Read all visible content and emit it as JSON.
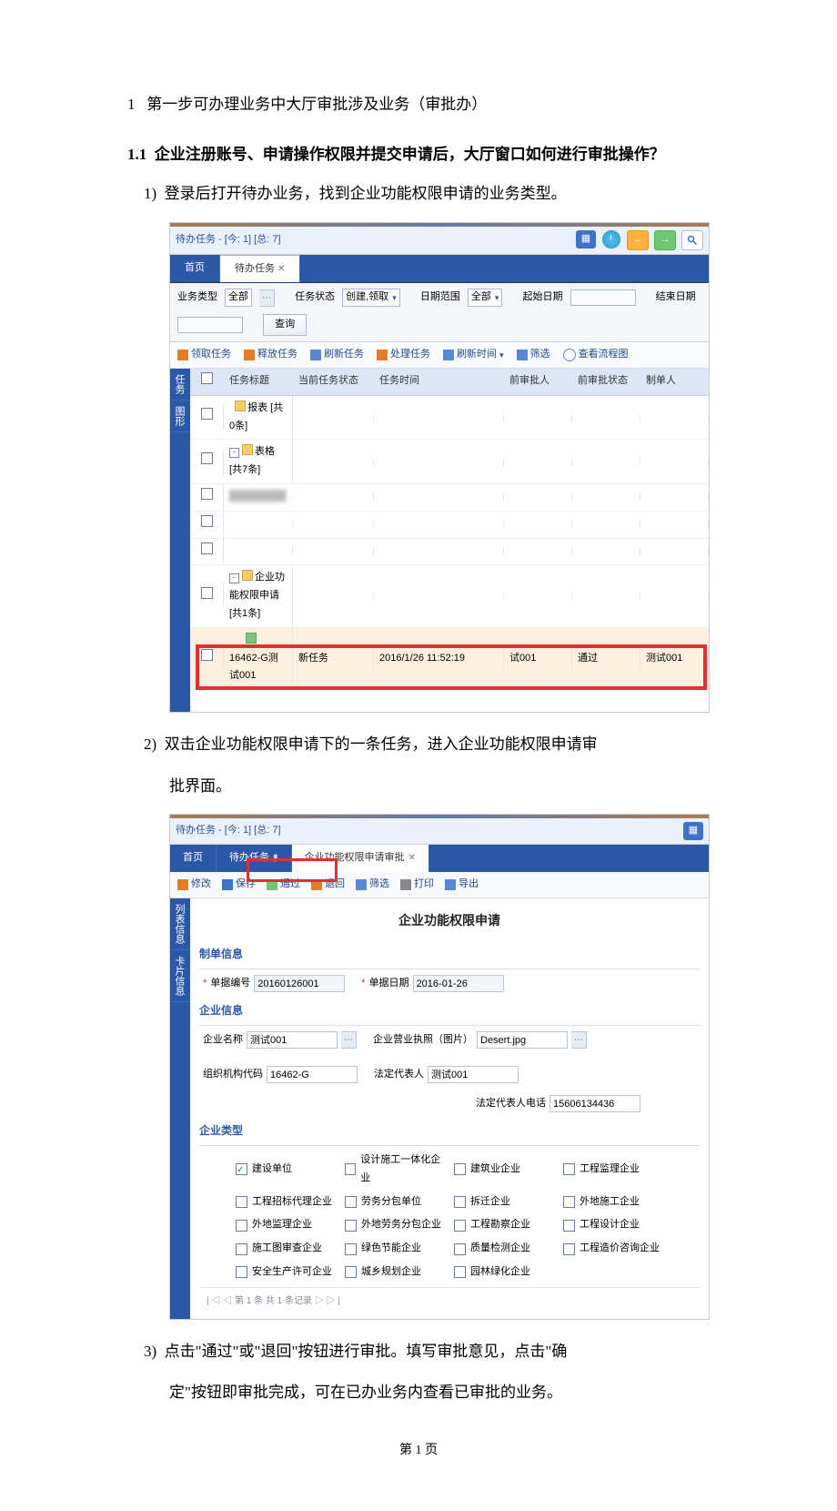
{
  "doc": {
    "h1_num": "1",
    "h1_text": "第一步可办理业务中大厅审批涉及业务（审批办）",
    "h2_num": "1.1",
    "h2_text": "企业注册账号、申请操作权限并提交申请后，大厅窗口如何进行审批操作？",
    "step1_num": "1)",
    "step1_text": "登录后打开待办业务，找到企业功能权限申请的业务类型。",
    "step2_num": "2)",
    "step2_text": "双击企业功能权限申请下的一条任务，进入企业功能权限申请审",
    "step2_text2": "批界面。",
    "step3_num": "3)",
    "step3_text": "点击\"通过\"或\"退回\"按钮进行审批。填写审批意见，点击\"确",
    "step3_text2": "定\"按钮即审批完成，可在已办业务内查看已审批的业务。",
    "page_footer": "第 1 页"
  },
  "app1": {
    "breadcrumb": "待办任务 - [今: 1] [总: 7]",
    "tabs": [
      "首页",
      "待办任务"
    ],
    "filter": {
      "biz_type_label": "业务类型",
      "biz_type_value": "全部",
      "task_state_label": "任务状态",
      "task_state_value": "创建,领取",
      "date_range_label": "日期范围",
      "date_range_value": "全部",
      "start_date_label": "起始日期",
      "end_date_label": "结束日期",
      "query_btn": "查询"
    },
    "toolbar": {
      "claim": "领取任务",
      "release": "释放任务",
      "refresh": "刷新任务",
      "process": "处理任务",
      "reftime": "刷新时间",
      "filter": "筛选",
      "flowchart": "查看流程图"
    },
    "sidetabs": {
      "task": "任务",
      "chart": "图形"
    },
    "columns": {
      "title": "任务标题",
      "state": "当前任务状态",
      "time": "任务时间",
      "prev_approver": "前审批人",
      "prev_state": "前审批状态",
      "maker": "制单人"
    },
    "rows": {
      "group_report": "报表 [共0条]",
      "group_form": "表格 [共7条]",
      "group_apply": "企业功能权限申请 [共1条]",
      "task_name": "16462-G测试001",
      "task_state": "新任务",
      "task_time": "2016/1/26 11:52:19",
      "task_pa": "试001",
      "task_ps": "通过",
      "task_maker": "测试001"
    }
  },
  "app2": {
    "breadcrumb": "待办任务 - [今: 1] [总: 7]",
    "tabs": {
      "home": "首页",
      "todo": "待办任务",
      "approve": "企业功能权限申请审批"
    },
    "toolbar": {
      "edit": "修改",
      "save": "保存",
      "pass": "通过",
      "reject": "退回",
      "filter": "筛选",
      "print": "打印",
      "export": "导出"
    },
    "sidetabs": {
      "list": "列表信息",
      "card": "卡片信息"
    },
    "form_title": "企业功能权限申请",
    "grp_bill": "制单信息",
    "grp_ent": "企业信息",
    "grp_types": "企业类型",
    "fields": {
      "bill_no_label": "单据编号",
      "bill_no": "20160126001",
      "bill_date_label": "单据日期",
      "bill_date": "2016-01-26",
      "ent_name_label": "企业名称",
      "ent_name": "测试001",
      "license_label": "企业营业执照（图片）",
      "license": "Desert.jpg",
      "org_code_label": "组织机构代码",
      "org_code": "16462-G",
      "legal_label": "法定代表人",
      "legal": "测试001",
      "legal_phone_label": "法定代表人电话",
      "legal_phone": "15606134436"
    },
    "types": [
      {
        "label": "建设单位",
        "checked": true
      },
      {
        "label": "设计施工一体化企业",
        "checked": false
      },
      {
        "label": "建筑业企业",
        "checked": false
      },
      {
        "label": "工程监理企业",
        "checked": false
      },
      {
        "label": "工程招标代理企业",
        "checked": false
      },
      {
        "label": "劳务分包单位",
        "checked": false
      },
      {
        "label": "拆迁企业",
        "checked": false
      },
      {
        "label": "外地施工企业",
        "checked": false
      },
      {
        "label": "外地监理企业",
        "checked": false
      },
      {
        "label": "外地劳务分包企业",
        "checked": false
      },
      {
        "label": "工程勘察企业",
        "checked": false
      },
      {
        "label": "工程设计企业",
        "checked": false
      },
      {
        "label": "施工图审查企业",
        "checked": false
      },
      {
        "label": "绿色节能企业",
        "checked": false
      },
      {
        "label": "质量检测企业",
        "checked": false
      },
      {
        "label": "工程造价咨询企业",
        "checked": false
      },
      {
        "label": "安全生产许可企业",
        "checked": false
      },
      {
        "label": "城乡规划企业",
        "checked": false
      },
      {
        "label": "园林绿化企业",
        "checked": false
      }
    ],
    "pager": "| ◁  ◁  第 1 条  共 1 条记录  ▷  ▷ |"
  }
}
